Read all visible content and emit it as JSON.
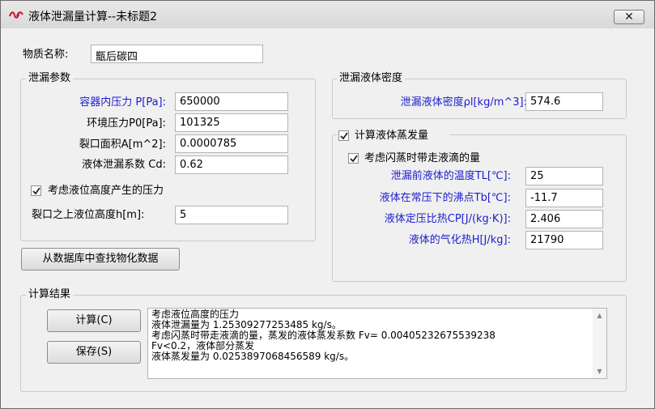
{
  "window": {
    "title": "液体泄漏量计算--未标题2",
    "close_glyph": "✕"
  },
  "material": {
    "label": "物质名称:",
    "value": "甑后碳四"
  },
  "leak_params": {
    "group_title": "泄漏参数",
    "fields": [
      {
        "label": "容器内压力 P[Pa]:",
        "value": "650000"
      },
      {
        "label": "环境压力P0[Pa]:",
        "value": "101325"
      },
      {
        "label": "裂口面积A[m^2]:",
        "value": "0.0000785"
      },
      {
        "label": "液体泄漏系数  Cd:",
        "value": "0.62"
      }
    ],
    "checkbox_label": "考虑液位高度产生的压力",
    "checkbox_checked": true,
    "height_label": "裂口之上液位高度h[m]:",
    "height_value": "5"
  },
  "density": {
    "group_title": "泄漏液体密度",
    "label": "泄漏液体密度ρl[kg/m^3]:",
    "value": "574.6"
  },
  "evaporation": {
    "group_title": "计算液体蒸发量",
    "group_checked": true,
    "droplet_label": "考虑闪蒸时带走液滴的量",
    "droplet_checked": true,
    "fields": [
      {
        "label": "泄漏前液体的温度TL[℃]:",
        "value": "25"
      },
      {
        "label": "液体在常压下的沸点Tb[℃]:",
        "value": "-11.7"
      },
      {
        "label": "液体定压比热CP[J/(kg·K)]:",
        "value": "2.406"
      },
      {
        "label": "液体的气化热H[J/kg]:",
        "value": "21790"
      }
    ]
  },
  "lookup_button": "从数据库中查找物化数据",
  "results": {
    "group_title": "计算结果",
    "calc_button": "计算(C)",
    "save_button": "保存(S)",
    "lines": [
      "考虑液位高度的压力",
      "液体泄漏量为 1.25309277253485 kg/s。",
      "考虑闪蒸时带走液滴的量，蒸发的液体蒸发系数 Fv= 0.00405232675539238",
      "Fv<0.2，液体部分蒸发",
      "液体蒸发量为 0.0253897068456589 kg/s。"
    ]
  },
  "colors": {
    "accent_label": "#1c1cd0",
    "background": "#f0f0f0"
  }
}
